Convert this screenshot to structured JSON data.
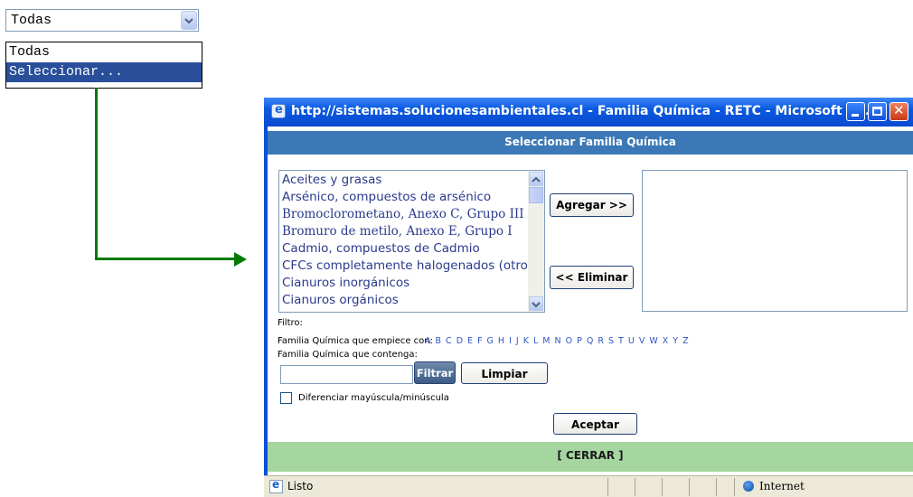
{
  "dropdown": {
    "value": "Todas",
    "options": [
      {
        "label": "Todas",
        "selected": false
      },
      {
        "label": "Seleccionar...",
        "selected": true
      }
    ]
  },
  "popup": {
    "window_title": "http://sistemas.solucionesambientales.cl - Familia Química - RETC - Microsoft In...",
    "header": "Seleccionar Familia Química",
    "list_items": [
      "Aceites y grasas",
      "Arsénico, compuestos de arsénico",
      "Bromoclorometano, Anexo C, Grupo III",
      "Bromuro de metilo, Anexo E, Grupo I",
      "Cadmio, compuestos de Cadmio",
      "CFCs completamente halogenados (otro",
      "Cianuros inorgánicos",
      "Cianuros orgánicos"
    ],
    "add_button": "Agregar >>",
    "remove_button": "<< Eliminar",
    "filter_label": "Filtro:",
    "starts_with_label": "Familia Química que empiece con:",
    "letters": "A B C D E F G H I J K L M N O P Q R S T U V W X Y Z",
    "contains_label": "Familia Química que contenga:",
    "filter_input_value": "",
    "filter_button": "Filtrar",
    "clear_button": "Limpiar",
    "case_checkbox_label": "Diferenciar mayúscula/minúscula",
    "case_checkbox_checked": false,
    "accept_button": "Aceptar",
    "close_link": "[ CERRAR ]",
    "status_text": "Listo",
    "zone_text": "Internet"
  },
  "colors": {
    "titlebar": "#0a5ae0",
    "header_bar": "#3b78b5",
    "close_bar": "#a6d6a0",
    "arrow": "#007a00",
    "letters": "#2f55c8",
    "list_text": "#2b3a8c"
  }
}
